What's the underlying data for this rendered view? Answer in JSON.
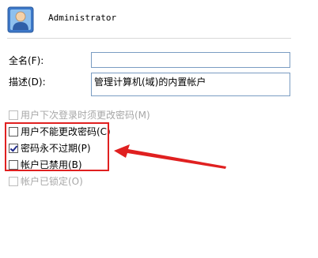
{
  "user": {
    "name": "Administrator",
    "avatar_icon": "user-account-icon"
  },
  "form": {
    "fullname_label": "全名(F):",
    "fullname_value": "",
    "description_label": "描述(D):",
    "description_value": "管理计算机(域)的内置帐户"
  },
  "options": [
    {
      "label": "用户下次登录时须更改密码(M)",
      "checked": false,
      "enabled": false
    },
    {
      "label": "用户不能更改密码(C)",
      "checked": false,
      "enabled": true
    },
    {
      "label": "密码永不过期(P)",
      "checked": true,
      "enabled": true
    },
    {
      "label": "帐户已禁用(B)",
      "checked": false,
      "enabled": true
    },
    {
      "label": "帐户已锁定(O)",
      "checked": false,
      "enabled": false
    }
  ],
  "annotation": {
    "highlight_color": "#e02020"
  }
}
